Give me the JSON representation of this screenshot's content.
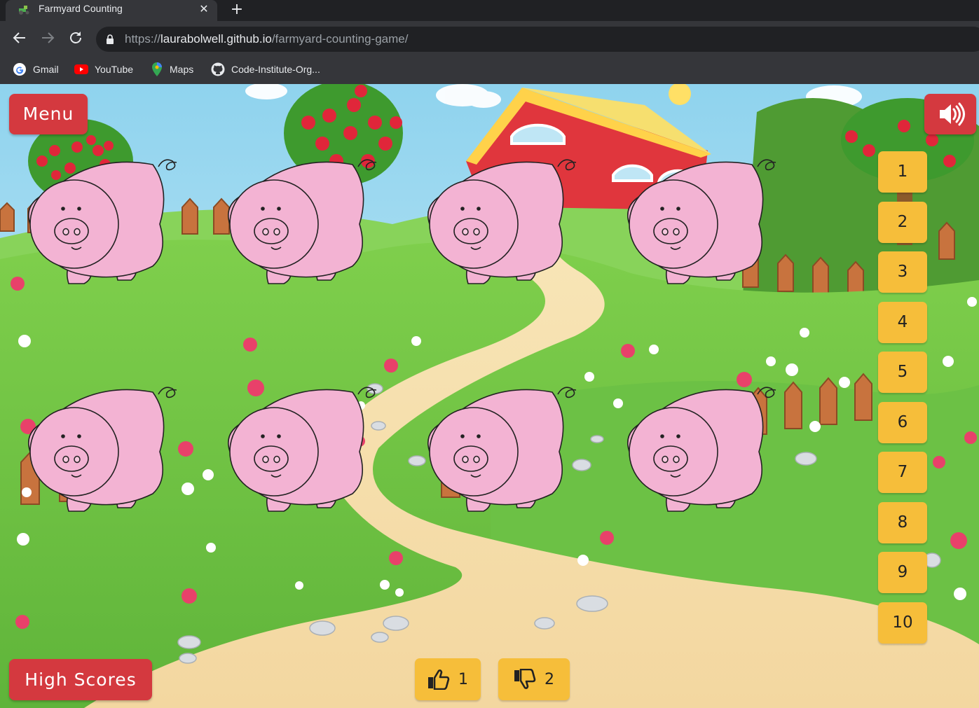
{
  "browser": {
    "tab_title": "Farmyard Counting",
    "url_scheme": "https://",
    "url_host": "laurabolwell.github.io",
    "url_path": "/farmyard-counting-game/",
    "bookmarks": [
      {
        "label": "Gmail",
        "icon": "google-icon"
      },
      {
        "label": "YouTube",
        "icon": "youtube-icon"
      },
      {
        "label": "Maps",
        "icon": "maps-icon"
      },
      {
        "label": "Code-Institute-Org...",
        "icon": "github-icon"
      }
    ]
  },
  "game": {
    "menu_label": "Menu",
    "sound_icon": "volume-icon",
    "high_scores_label": "High Scores",
    "answer_buttons": [
      "1",
      "2",
      "3",
      "4",
      "5",
      "6",
      "7",
      "8",
      "9",
      "10"
    ],
    "correct_count": "1",
    "incorrect_count": "2",
    "animal": "pig",
    "animal_count": 8,
    "colors": {
      "red_button": "#d4393f",
      "yellow_button": "#f6be3a",
      "pig_pink": "#f3b3d3"
    }
  }
}
